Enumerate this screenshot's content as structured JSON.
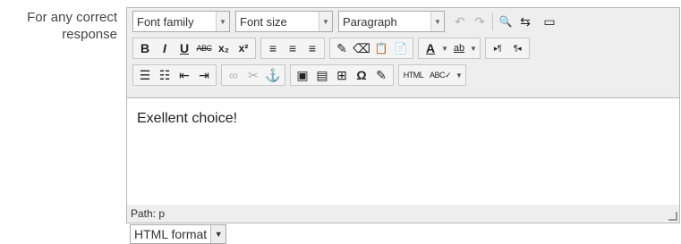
{
  "field_label_line1": "For any correct",
  "field_label_line2": "response",
  "toolbar": {
    "font_family": "Font family",
    "font_size": "Font size",
    "block_format": "Paragraph"
  },
  "editor_content": "Exellent choice!",
  "status_path": "Path: p",
  "format_select": "HTML format",
  "icons": {
    "undo": "↶",
    "redo": "↷",
    "find": "🔍",
    "replace": "⇆",
    "fullscreen": "▭",
    "bold": "B",
    "italic": "I",
    "underline": "U",
    "strikethrough": "ABC",
    "subscript": "x₂",
    "superscript": "x²",
    "align_left": "≡",
    "align_center": "≡",
    "align_right": "≡",
    "clean": "✎",
    "eraser": "⌫",
    "paste_text": "📋",
    "paste_word": "📄",
    "forecolor": "A",
    "backcolor": "ab",
    "ltr": "▸¶",
    "rtl": "¶◂",
    "bullist": "☰",
    "numlist": "☷",
    "outdent": "⇤",
    "indent": "⇥",
    "link": "∞",
    "unlink": "✂",
    "anchor": "⚓",
    "image": "▣",
    "media": "▤",
    "table": "⊞",
    "charmap": "Ω",
    "edit": "✎",
    "html": "HTML",
    "spell": "ABC✓"
  }
}
